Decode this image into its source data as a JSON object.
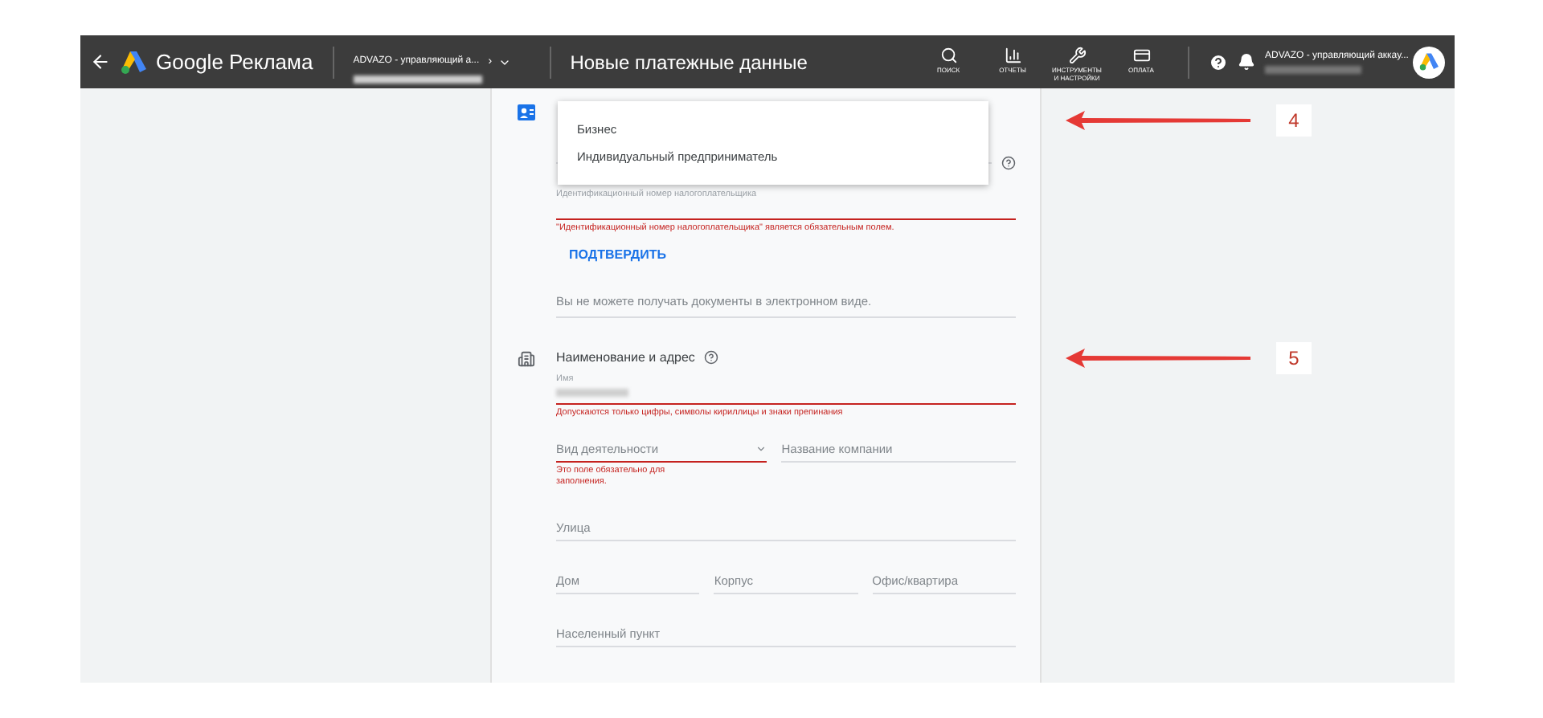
{
  "header": {
    "brand": "Google Реклама",
    "account_switcher": {
      "name": "ADVAZO - управляющий а...",
      "caret": "›"
    },
    "page_title": "Новые платежные данные",
    "tools": [
      {
        "kind": "search",
        "label": "ПОИСК"
      },
      {
        "kind": "reports",
        "label": "ОТЧЕТЫ"
      },
      {
        "kind": "tools",
        "label": "ИНСТРУМЕНТЫ И НАСТРОЙКИ"
      },
      {
        "kind": "billing",
        "label": "ОПЛАТА"
      }
    ],
    "account": {
      "name": "ADVAZO - управляющий аккау..."
    }
  },
  "tax_section": {
    "menu": {
      "items": [
        {
          "label": "Бизнес",
          "selected": false
        },
        {
          "label": "Индивидуальный предприниматель",
          "selected": false
        }
      ]
    },
    "tin_label": "Идентификационный номер налогоплательщика",
    "tin_error": "\"Идентификационный номер налогоплательщика\" является обязательным полем.",
    "verify_button": "ПОДТВЕРДИТЬ",
    "edocs_note": "Вы не можете получать документы в электронном виде."
  },
  "address_section": {
    "title": "Наименование и адрес",
    "name_field": {
      "label": "Имя",
      "error": "Допускаются только цифры, символы кириллицы и знаки препинания"
    },
    "rows": [
      {
        "fields": [
          {
            "kind": "select",
            "placeholder": "Вид деятельности",
            "error": "Это поле обязательно для заполнения."
          },
          {
            "kind": "text",
            "placeholder": "Название компании"
          }
        ]
      },
      {
        "fields": [
          {
            "kind": "text",
            "placeholder": "Улица"
          }
        ]
      },
      {
        "fields": [
          {
            "kind": "text",
            "placeholder": "Дом"
          },
          {
            "kind": "text",
            "placeholder": "Корпус"
          },
          {
            "kind": "text",
            "placeholder": "Офис/квартира"
          }
        ]
      },
      {
        "fields": [
          {
            "kind": "text",
            "placeholder": "Населенный пункт"
          }
        ]
      }
    ]
  },
  "annotations": [
    {
      "number": "4"
    },
    {
      "number": "5"
    }
  ]
}
